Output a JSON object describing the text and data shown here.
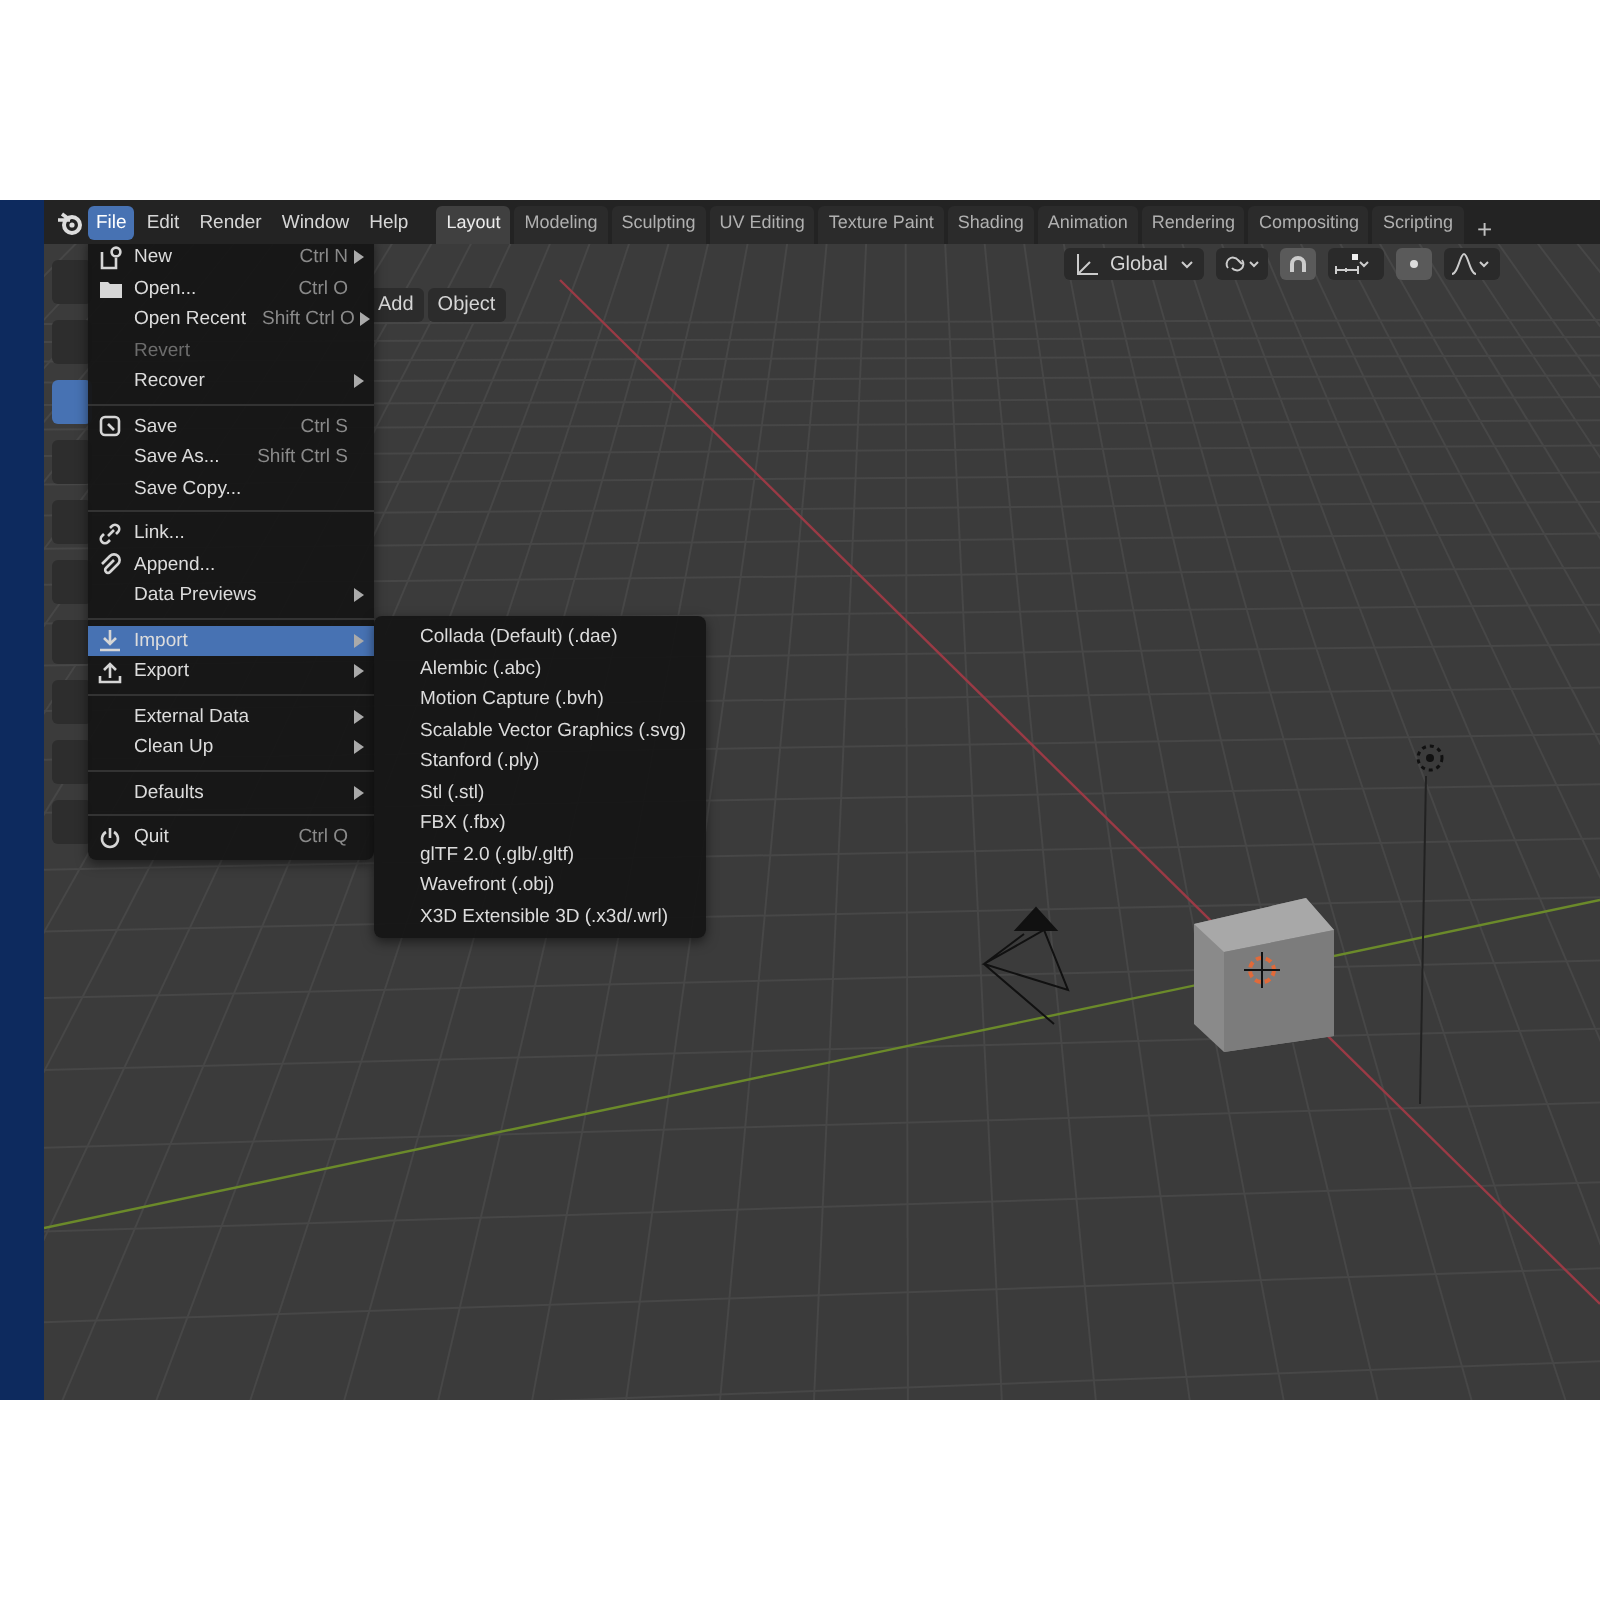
{
  "topbar": {
    "menus": [
      {
        "label": "File",
        "selected": true
      },
      {
        "label": "Edit",
        "selected": false
      },
      {
        "label": "Render",
        "selected": false
      },
      {
        "label": "Window",
        "selected": false
      },
      {
        "label": "Help",
        "selected": false
      }
    ],
    "workspaces": [
      {
        "label": "Layout",
        "selected": true
      },
      {
        "label": "Modeling",
        "selected": false
      },
      {
        "label": "Sculpting",
        "selected": false
      },
      {
        "label": "UV Editing",
        "selected": false
      },
      {
        "label": "Texture Paint",
        "selected": false
      },
      {
        "label": "Shading",
        "selected": false
      },
      {
        "label": "Animation",
        "selected": false
      },
      {
        "label": "Rendering",
        "selected": false
      },
      {
        "label": "Compositing",
        "selected": false
      },
      {
        "label": "Scripting",
        "selected": false
      }
    ],
    "add_workspace": "+"
  },
  "viewport_header": {
    "menus": [
      "Add",
      "Object"
    ],
    "transform_orientation": "Global"
  },
  "file_menu": {
    "groups": [
      [
        {
          "label": "New",
          "shortcut": "Ctrl N",
          "submenu": true,
          "disabled": false,
          "selected": false
        },
        {
          "label": "Open...",
          "shortcut": "Ctrl O",
          "submenu": false,
          "disabled": false,
          "selected": false
        },
        {
          "label": "Open Recent",
          "shortcut": "Shift Ctrl O",
          "submenu": true,
          "disabled": false,
          "selected": false
        },
        {
          "label": "Revert",
          "submenu": false,
          "disabled": true,
          "selected": false
        },
        {
          "label": "Recover",
          "submenu": true,
          "disabled": false,
          "selected": false
        }
      ],
      [
        {
          "label": "Save",
          "shortcut": "Ctrl S",
          "submenu": false,
          "disabled": false,
          "selected": false
        },
        {
          "label": "Save As...",
          "shortcut": "Shift Ctrl S",
          "submenu": false,
          "disabled": false,
          "selected": false
        },
        {
          "label": "Save Copy...",
          "submenu": false,
          "disabled": false,
          "selected": false
        }
      ],
      [
        {
          "label": "Link...",
          "submenu": false,
          "disabled": false,
          "selected": false
        },
        {
          "label": "Append...",
          "submenu": false,
          "disabled": false,
          "selected": false
        },
        {
          "label": "Data Previews",
          "submenu": true,
          "disabled": false,
          "selected": false
        }
      ],
      [
        {
          "label": "Import",
          "submenu": true,
          "disabled": false,
          "selected": true
        },
        {
          "label": "Export",
          "submenu": true,
          "disabled": false,
          "selected": false
        }
      ],
      [
        {
          "label": "External Data",
          "submenu": true,
          "disabled": false,
          "selected": false
        },
        {
          "label": "Clean Up",
          "submenu": true,
          "disabled": false,
          "selected": false
        }
      ],
      [
        {
          "label": "Defaults",
          "submenu": true,
          "disabled": false,
          "selected": false
        }
      ],
      [
        {
          "label": "Quit",
          "shortcut": "Ctrl Q",
          "submenu": false,
          "disabled": false,
          "selected": false
        }
      ]
    ]
  },
  "import_menu": {
    "items": [
      "Collada (Default) (.dae)",
      "Alembic (.abc)",
      "Motion Capture (.bvh)",
      "Scalable Vector Graphics (.svg)",
      "Stanford (.ply)",
      "Stl (.stl)",
      "FBX (.fbx)",
      "glTF 2.0 (.glb/.gltf)",
      "Wavefront (.obj)",
      "X3D Extensible 3D (.x3d/.wrl)"
    ]
  }
}
